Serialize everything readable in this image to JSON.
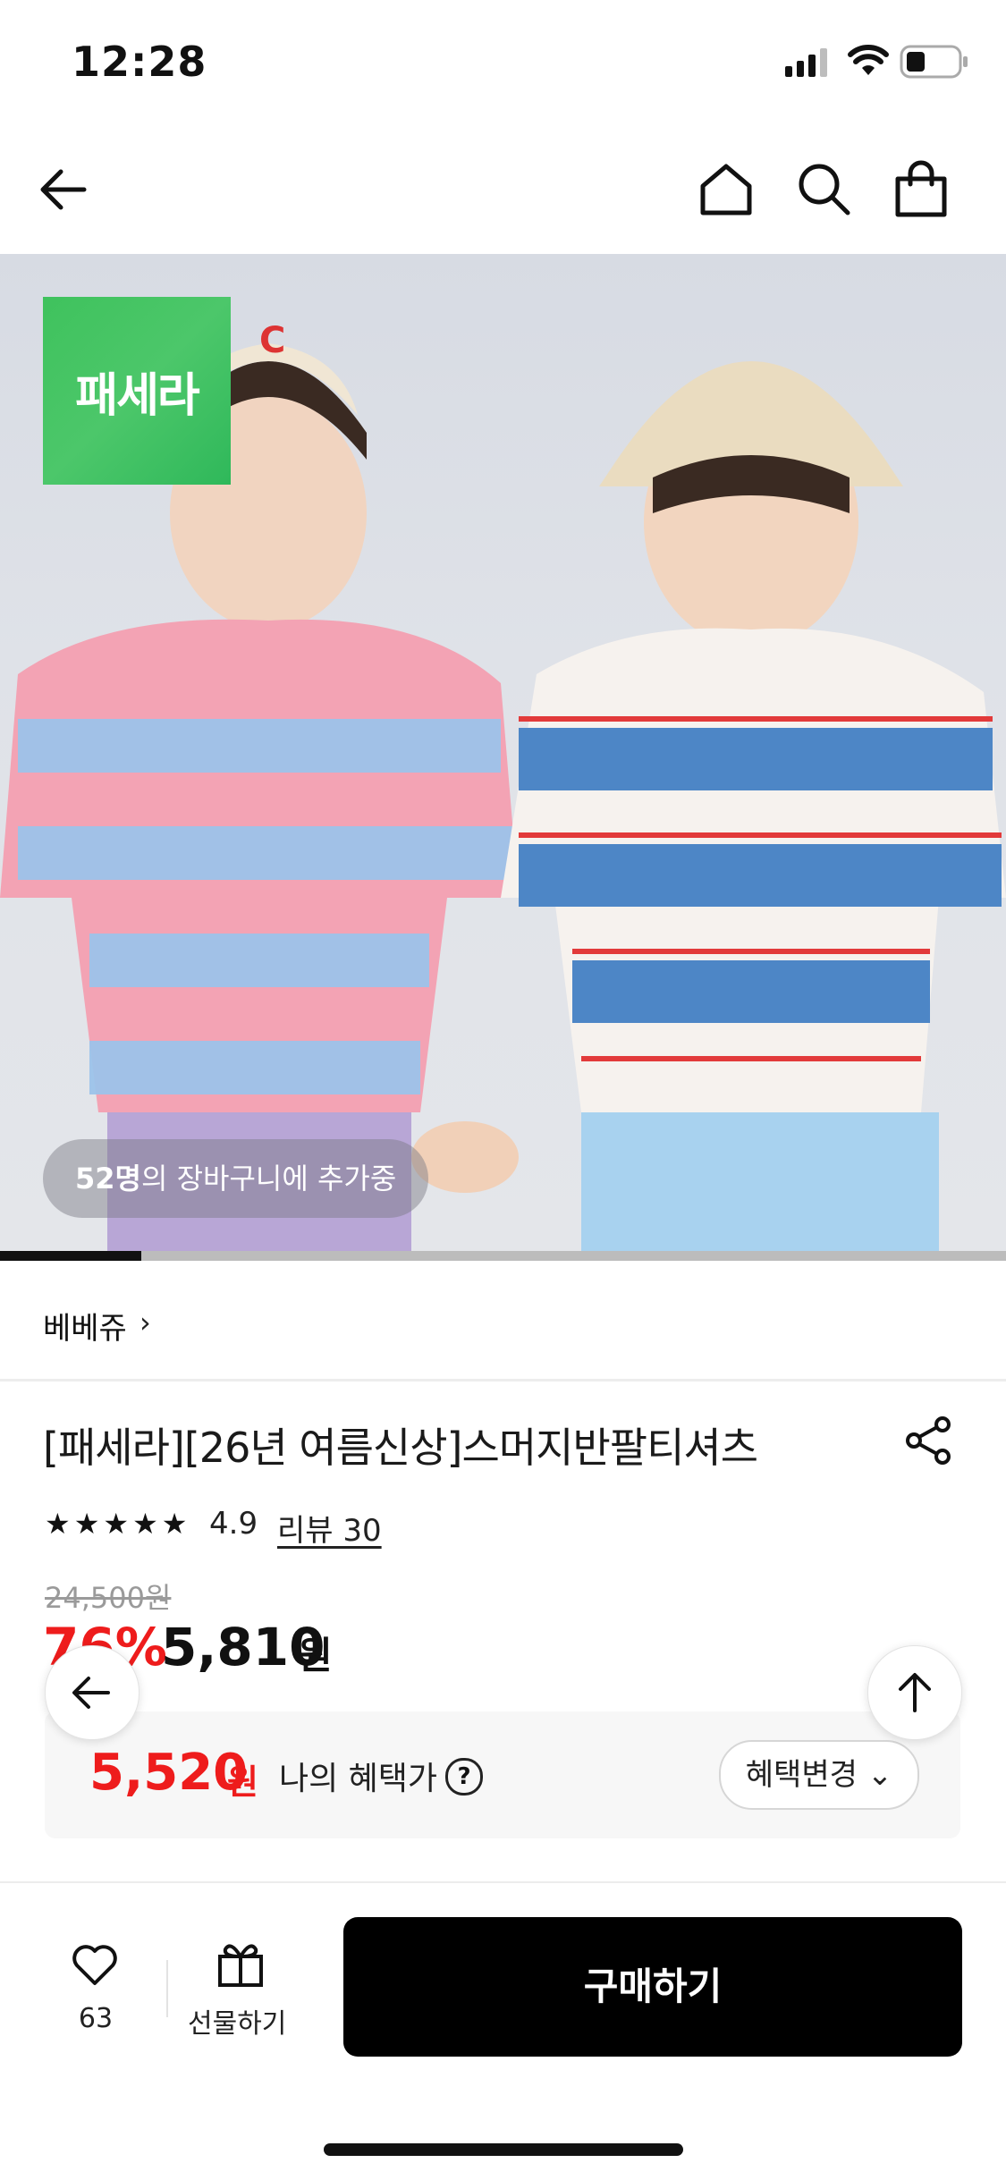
{
  "status_bar": {
    "time": "12:28"
  },
  "nav": {
    "back_icon": "arrow-left-icon",
    "home_icon": "home-icon",
    "search_icon": "search-icon",
    "cart_icon": "shopping-bag-icon"
  },
  "hero": {
    "logo_text": "패세라",
    "cart_count": "52명",
    "cart_suffix": "의 장바구니에 추가중",
    "progress": 0.14
  },
  "brand": {
    "name": "베베쥬",
    "chevron": "›"
  },
  "product": {
    "title": "[패세라][26년 여름신상]스머지반팔티셔츠",
    "stars": "★★★★★",
    "rating": "4.9",
    "reviews_label": "리뷰 30",
    "original_price": "24,500원",
    "discount": "76%",
    "price": "5,810",
    "price_unit": "원"
  },
  "benefit": {
    "price": "5,520",
    "unit": "원",
    "label": "나의 혜택가",
    "help": "?",
    "change_button": "혜택변경"
  },
  "bottom_bar": {
    "like_count": "63",
    "gift_label": "선물하기",
    "buy_label": "구매하기"
  },
  "colors": {
    "accent_red": "#ee1c1c",
    "logo_green": "#3fc25d",
    "buy_bg": "#000000"
  }
}
